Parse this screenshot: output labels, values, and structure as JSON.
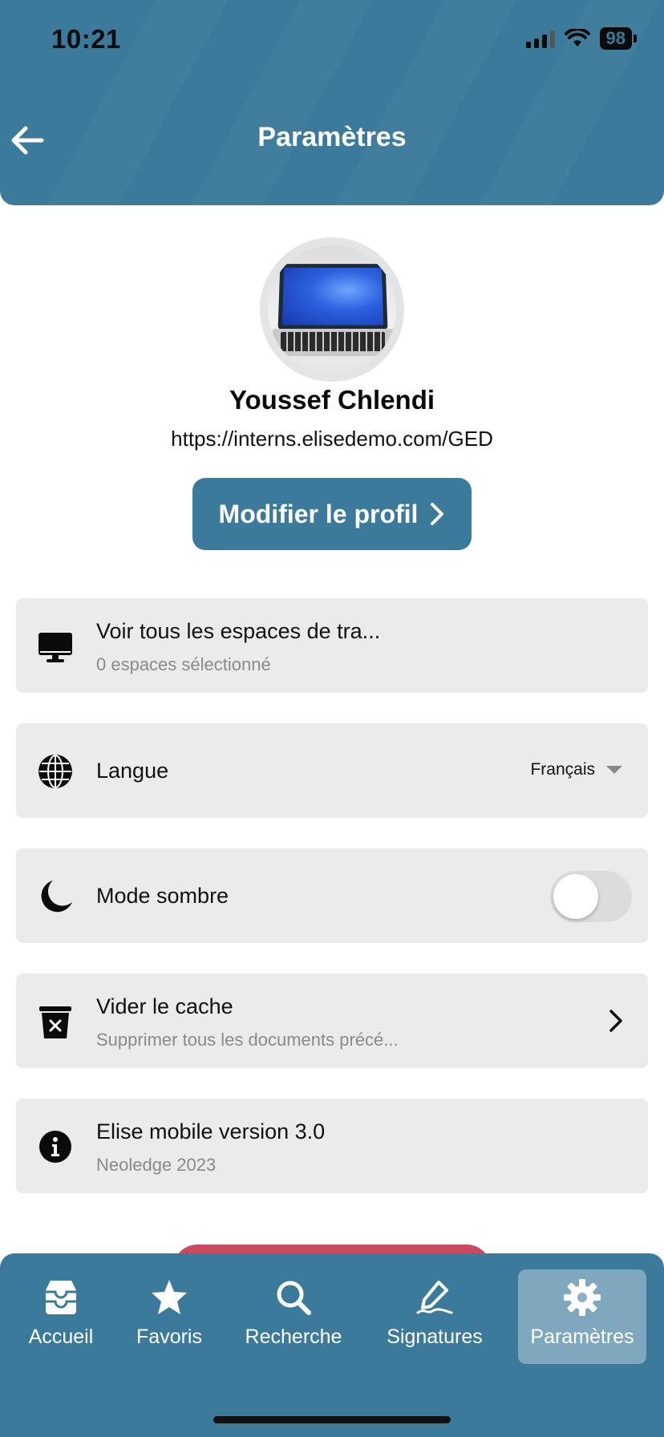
{
  "status_bar": {
    "time": "10:21",
    "battery": "98"
  },
  "header": {
    "title": "Paramètres",
    "accent_color": "#3b7a9b"
  },
  "profile": {
    "name": "Youssef Chlendi",
    "url": "https://interns.elisedemo.com/GED",
    "edit_button": "Modifier le profil"
  },
  "settings": {
    "workspaces": {
      "title": "Voir tous les espaces de tra...",
      "subtitle": "0 espaces sélectionné",
      "icon": "monitor-icon"
    },
    "language": {
      "title": "Langue",
      "value": "Français",
      "icon": "globe-icon"
    },
    "dark_mode": {
      "title": "Mode sombre",
      "enabled": false,
      "icon": "moon-icon"
    },
    "cache": {
      "title": "Vider le cache",
      "subtitle": "Supprimer tous les documents précé...",
      "icon": "trash-icon"
    },
    "version": {
      "title": "Elise mobile version 3.0",
      "subtitle": "Neoledge 2023",
      "icon": "info-icon"
    }
  },
  "bottom_nav": {
    "items": [
      {
        "label": "Accueil",
        "icon": "inbox-icon"
      },
      {
        "label": "Favoris",
        "icon": "star-icon"
      },
      {
        "label": "Recherche",
        "icon": "search-icon"
      },
      {
        "label": "Signatures",
        "icon": "signature-icon"
      },
      {
        "label": "Paramètres",
        "icon": "gear-icon",
        "active": true
      }
    ]
  }
}
